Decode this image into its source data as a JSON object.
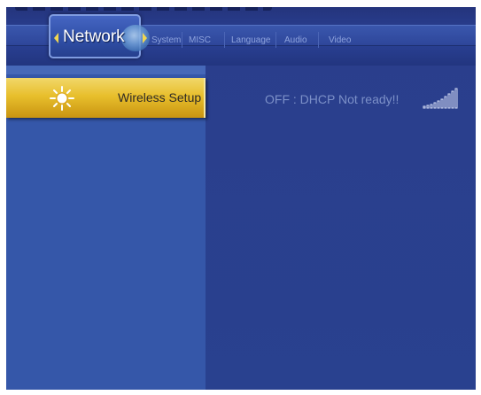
{
  "tabs": {
    "active": "Network",
    "items": [
      "System",
      "MISC",
      "Language",
      "Audio",
      "Video"
    ]
  },
  "menu": {
    "selected_label": "Wireless Setup",
    "selected_icon": "sun-icon"
  },
  "status": {
    "text": "OFF : DHCP Not ready!!",
    "signal_icon": "signal-bars-icon"
  },
  "colors": {
    "accent": "#e8bf2c",
    "background": "#29418f"
  }
}
